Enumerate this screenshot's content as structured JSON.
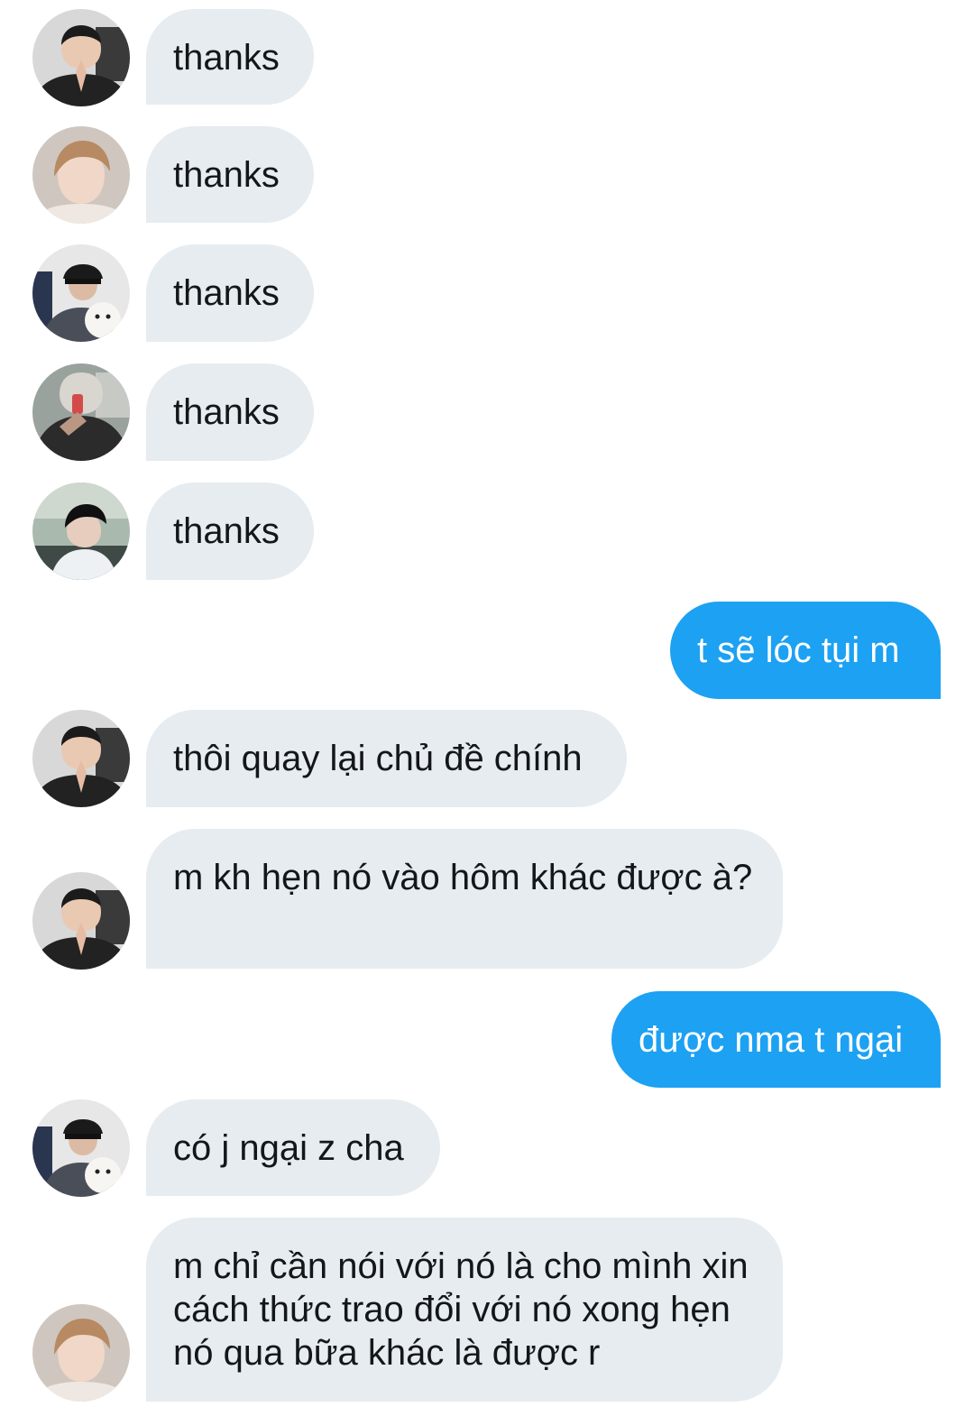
{
  "colors": {
    "incoming_bubble": "#e6ecf0",
    "outgoing_bubble": "#1da1f2",
    "incoming_text": "#14171a",
    "outgoing_text": "#ffffff"
  },
  "messages": [
    {
      "direction": "incoming",
      "avatar": "avatar-boy-praying-hands",
      "text": "thanks"
    },
    {
      "direction": "incoming",
      "avatar": "avatar-boy-light-hair",
      "text": "thanks"
    },
    {
      "direction": "incoming",
      "avatar": "avatar-boy-cap-dog",
      "text": "thanks"
    },
    {
      "direction": "incoming",
      "avatar": "avatar-boy-mirror-selfie",
      "text": "thanks"
    },
    {
      "direction": "incoming",
      "avatar": "avatar-boy-black-hair",
      "text": "thanks"
    },
    {
      "direction": "outgoing",
      "text": "t sẽ lóc tụi m"
    },
    {
      "direction": "incoming",
      "avatar": "avatar-boy-praying-hands",
      "text": "thôi quay lại chủ đề chính"
    },
    {
      "direction": "incoming",
      "avatar": "avatar-boy-praying-hands",
      "text": "m kh hẹn nó vào hôm khác được à?"
    },
    {
      "direction": "outgoing",
      "text": "được nma t ngại"
    },
    {
      "direction": "incoming",
      "avatar": "avatar-boy-cap-dog",
      "text": "có j ngại z cha"
    },
    {
      "direction": "incoming",
      "avatar": "avatar-boy-light-hair",
      "text": "m chỉ cần nói với nó là cho mình xin cách thức trao đổi với nó xong hẹn nó qua bữa khác là được r"
    }
  ]
}
